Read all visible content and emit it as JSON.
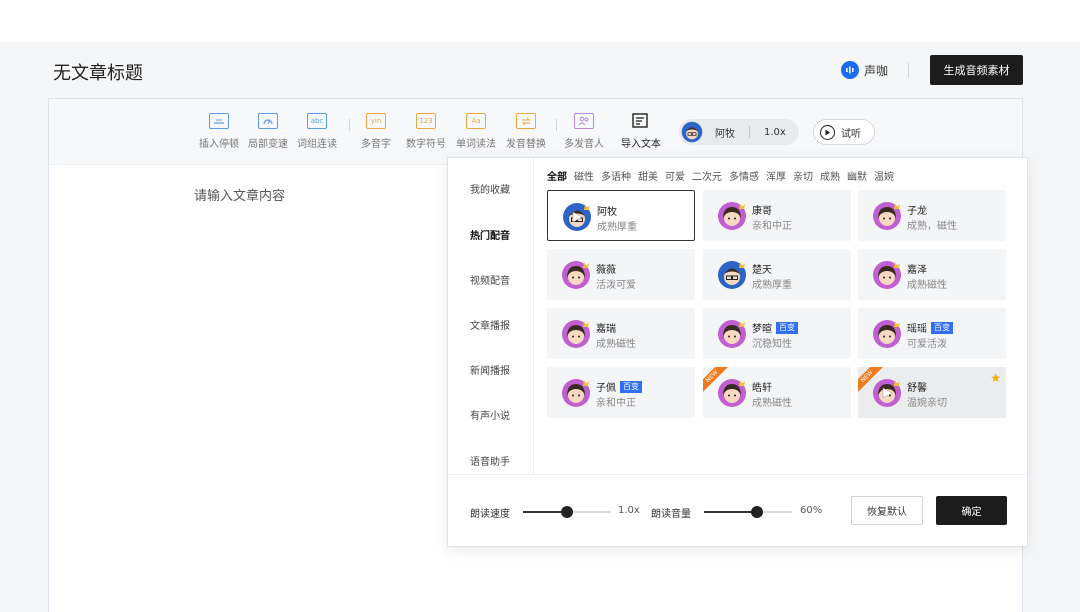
{
  "header": {
    "title": "无文章标题",
    "brand_name": "声咖",
    "generate_label": "生成音频素材"
  },
  "toolbar": {
    "tools": [
      {
        "label": "插入停顿",
        "icon": "pause-insert-icon"
      },
      {
        "label": "局部变速",
        "icon": "speed-gauge-icon"
      },
      {
        "label": "词组连读",
        "icon": "phrase-link-icon",
        "glyph": "abc"
      },
      {
        "label": "多音字",
        "icon": "polyphone-icon",
        "glyph": "yin"
      },
      {
        "label": "数字符号",
        "icon": "number-symbol-icon",
        "glyph": "123"
      },
      {
        "label": "单词读法",
        "icon": "word-pronounce-icon",
        "glyph": "Aa"
      },
      {
        "label": "发音替换",
        "icon": "pronounce-replace-icon"
      },
      {
        "label": "多发音人",
        "icon": "multi-speaker-icon"
      },
      {
        "label": "导入文本",
        "icon": "import-text-icon"
      }
    ],
    "voice_name": "阿牧",
    "voice_rate": "1.0x",
    "listen_label": "试听"
  },
  "editor": {
    "placeholder": "请输入文章内容"
  },
  "panel": {
    "categories": [
      "我的收藏",
      "热门配音",
      "视频配音",
      "文章播报",
      "新闻播报",
      "有声小说",
      "语音助手"
    ],
    "active_category": "热门配音",
    "tags": [
      "全部",
      "磁性",
      "多语种",
      "甜美",
      "可爱",
      "二次元",
      "多情感",
      "浑厚",
      "亲切",
      "成熟",
      "幽默",
      "温婉"
    ],
    "active_tag": "全部",
    "voices": [
      {
        "name": "阿牧",
        "desc": "成熟厚重",
        "avatar": "male",
        "selected": true
      },
      {
        "name": "康哥",
        "desc": "亲和中正",
        "avatar": "female"
      },
      {
        "name": "子龙",
        "desc": "成熟，磁性",
        "avatar": "female"
      },
      {
        "name": "薇薇",
        "desc": "活泼可爱",
        "avatar": "female"
      },
      {
        "name": "楚天",
        "desc": "成熟厚重",
        "avatar": "male"
      },
      {
        "name": "嘉泽",
        "desc": "成熟磁性",
        "avatar": "female"
      },
      {
        "name": "嘉瑞",
        "desc": "成熟磁性",
        "avatar": "female"
      },
      {
        "name": "梦暄",
        "desc": "沉稳知性",
        "avatar": "female",
        "badge": "百变"
      },
      {
        "name": "瑶瑶",
        "desc": "可爱活泼",
        "avatar": "female",
        "badge": "百变"
      },
      {
        "name": "子佩",
        "desc": "亲和中正",
        "avatar": "female",
        "badge": "百变"
      },
      {
        "name": "皓轩",
        "desc": "成熟磁性",
        "avatar": "female",
        "is_new": true
      },
      {
        "name": "舒馨",
        "desc": "温婉亲切",
        "avatar": "female",
        "is_new": true,
        "starred": true,
        "hovered": true
      }
    ],
    "new_label": "NEW",
    "speed_label": "朗读速度",
    "speed_value": "1.0x",
    "speed_fraction": 0.5,
    "volume_label": "朗读音量",
    "volume_value": "60%",
    "volume_fraction": 0.6,
    "reset_label": "恢复默认",
    "confirm_label": "确定"
  },
  "colors": {
    "dark_button": "#1c1c1c",
    "tool_blue": "#5b9be8",
    "tool_orange": "#f0a640",
    "tool_purple": "#b58ae0",
    "badge_blue": "#2f6ff0",
    "new_orange": "#f07b1c",
    "avatar_pink": "#c060d0",
    "avatar_blue": "#2c64c8"
  }
}
